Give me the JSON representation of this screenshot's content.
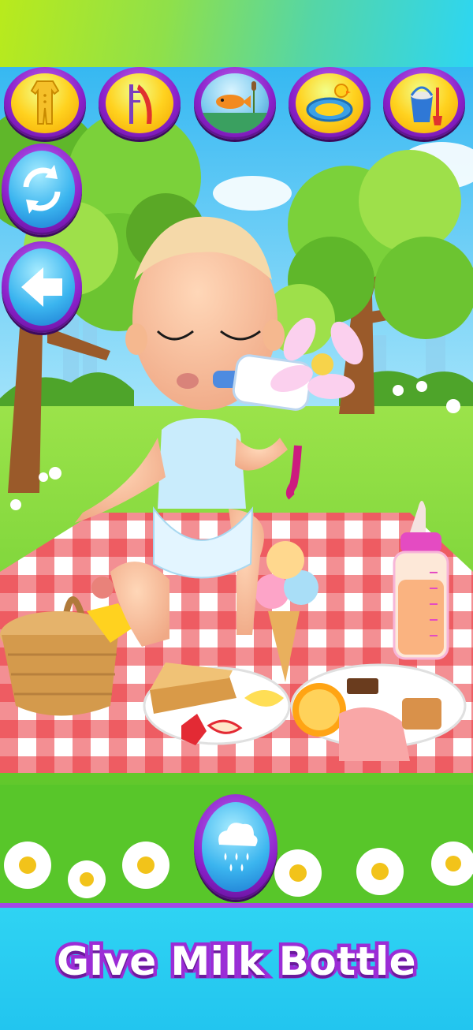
{
  "toolbar": {
    "items": [
      {
        "name": "clothes-category",
        "icon": "onesie-icon"
      },
      {
        "name": "playground-category",
        "icon": "slide-icon"
      },
      {
        "name": "pond-category",
        "icon": "fish-icon"
      },
      {
        "name": "pool-category",
        "icon": "swim-ring-icon"
      },
      {
        "name": "sandbox-category",
        "icon": "bucket-icon"
      }
    ]
  },
  "side_buttons": [
    {
      "name": "refresh-button",
      "icon": "refresh-icon"
    },
    {
      "name": "back-button",
      "icon": "back-arrow-icon"
    }
  ],
  "rain_button": {
    "icon": "rain-cloud-icon"
  },
  "caption": {
    "text": "Give Milk Bottle"
  },
  "colors": {
    "button_border": "#8a20c9",
    "button_fill": "#ffd21f",
    "side_fill": "#3bb5ef",
    "caption_stroke": "#9b2cd6",
    "bottom_band": "#2fd3f3"
  }
}
